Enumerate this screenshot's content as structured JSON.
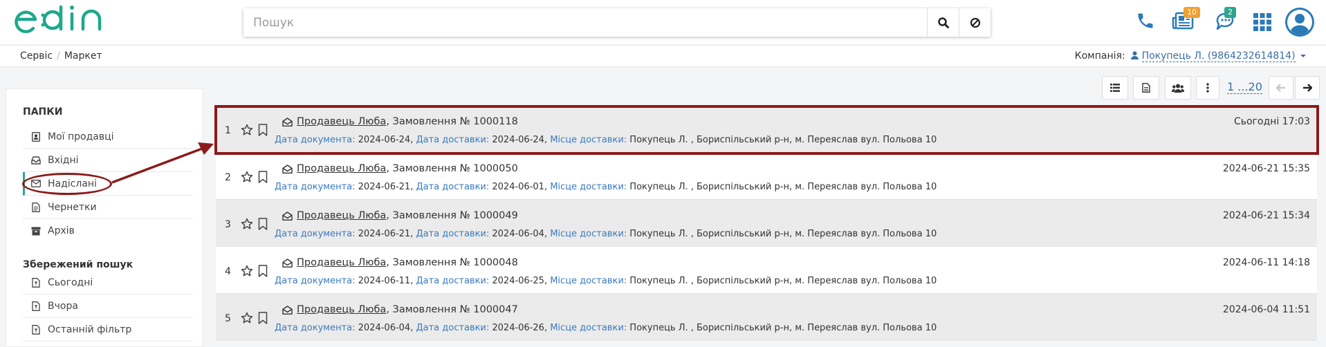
{
  "header": {
    "logo_text": "edin",
    "search_placeholder": "Пошук",
    "badges": {
      "news": "10",
      "messages": "2"
    },
    "icons": [
      "phone-icon",
      "news-icon",
      "chat-icon",
      "apps-grid-icon",
      "user-avatar-icon"
    ]
  },
  "breadcrumbs": [
    "Сервіс",
    "Маркет"
  ],
  "company": {
    "label": "Компанія:",
    "value": "Покупець Л. (9864232614814)"
  },
  "sidebar": {
    "folders_title": "ПАПКИ",
    "folders": [
      {
        "label": "Мої продавці",
        "icon": "contact-card-icon"
      },
      {
        "label": "Вхідні",
        "icon": "inbox-icon"
      },
      {
        "label": "Надіслані",
        "icon": "envelope-icon",
        "active": true
      },
      {
        "label": "Чернетки",
        "icon": "draft-document-icon"
      },
      {
        "label": "Архів",
        "icon": "archive-icon"
      }
    ],
    "saved_title": "Збережений пошук",
    "saved": [
      {
        "label": "Сьогодні",
        "icon": "saved-filter-icon"
      },
      {
        "label": "Вчора",
        "icon": "saved-filter-icon"
      },
      {
        "label": "Останній фільтр",
        "icon": "saved-filter-icon"
      }
    ]
  },
  "toolbar": {
    "pager": "1 ...20"
  },
  "labels": {
    "doc_date": "Дата документа:",
    "delivery_date": "Дата доставки:",
    "delivery_place": "Місце доставки:"
  },
  "documents": [
    {
      "n": "1",
      "seller": "Продавець Люба",
      "title": ", Замовлення № 1000118",
      "doc_date": "2024-06-24,",
      "delivery_date": "2024-06-24,",
      "place": "Покупець Л. , Бориспільський р-н, м. Переяслав вул. Польова 10",
      "time": "Сьогодні 17:03"
    },
    {
      "n": "2",
      "seller": "Продавець Люба",
      "title": ", Замовлення № 1000050",
      "doc_date": "2024-06-21,",
      "delivery_date": "2024-06-01,",
      "place": "Покупець Л. , Бориспільський р-н, м. Переяслав вул. Польова 10",
      "time": "2024-06-21 15:35"
    },
    {
      "n": "3",
      "seller": "Продавець Люба",
      "title": ", Замовлення № 1000049",
      "doc_date": "2024-06-21,",
      "delivery_date": "2024-06-04,",
      "place": "Покупець Л. , Бориспільський р-н, м. Переяслав вул. Польова 10",
      "time": "2024-06-21 15:34"
    },
    {
      "n": "4",
      "seller": "Продавець Люба",
      "title": ", Замовлення № 1000048",
      "doc_date": "2024-06-11,",
      "delivery_date": "2024-06-25,",
      "place": "Покупець Л. , Бориспільський р-н, м. Переяслав вул. Польова 10",
      "time": "2024-06-11 14:18"
    },
    {
      "n": "5",
      "seller": "Продавець Люба",
      "title": ", Замовлення № 1000047",
      "doc_date": "2024-06-04,",
      "delivery_date": "2024-06-26,",
      "place": "Покупець Л. , Бориспільський р-н, м. Переяслав вул. Польова 10",
      "time": "2024-06-04 11:51"
    }
  ],
  "colors": {
    "brand": "#1ea88c",
    "link": "#3a6ea5",
    "annotation": "#8b1a1a",
    "badge_orange": "#f0a030",
    "badge_green": "#2ea58b"
  }
}
